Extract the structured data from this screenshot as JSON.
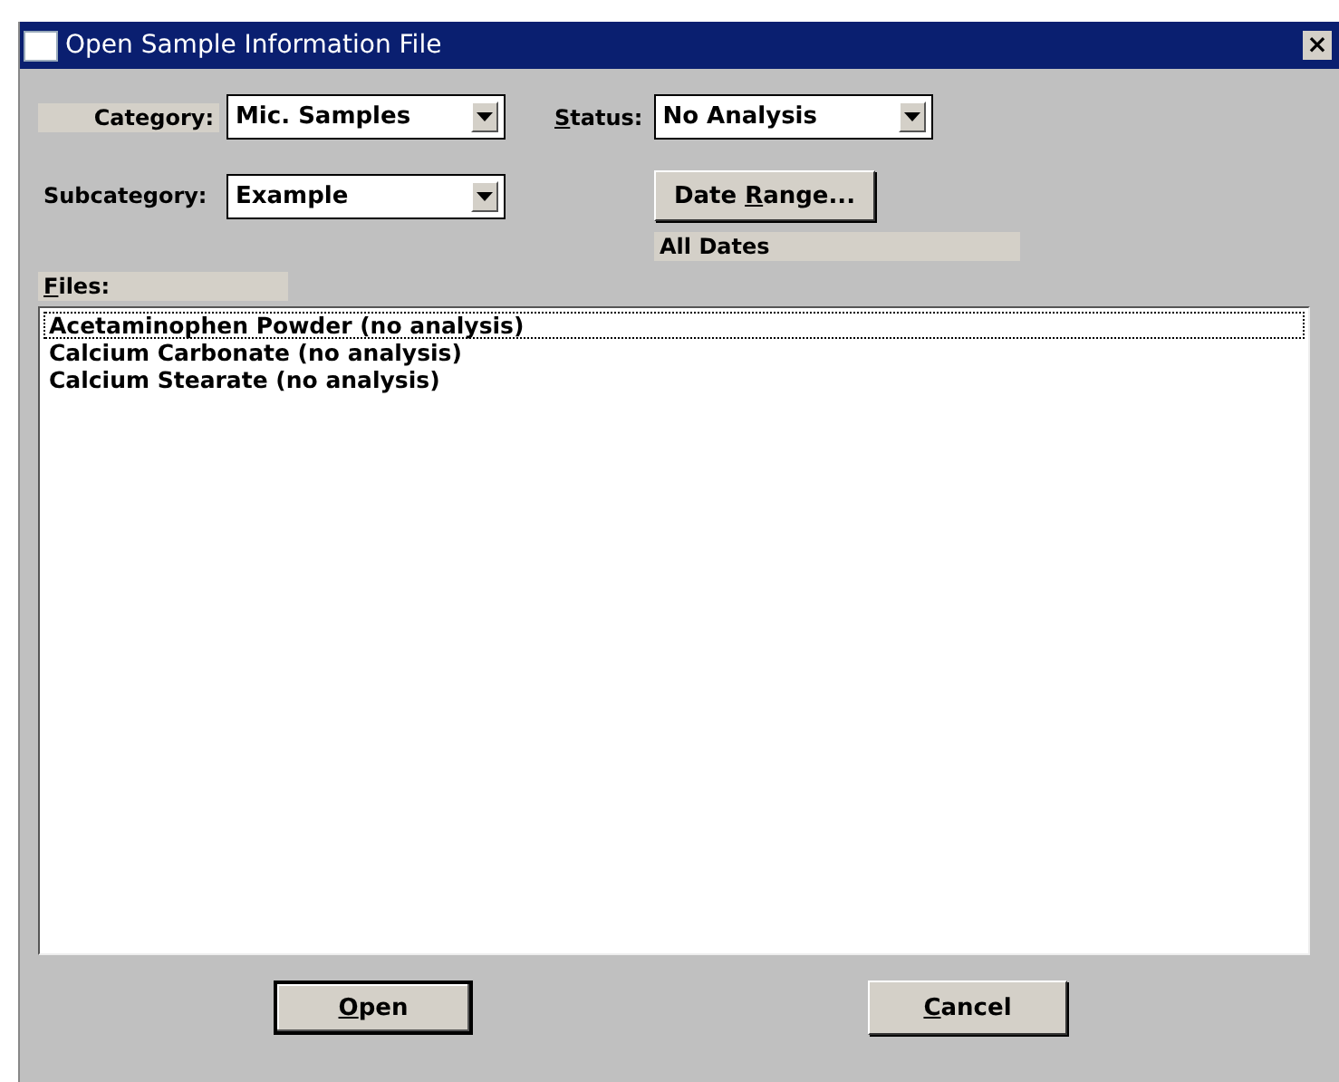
{
  "window": {
    "title": "Open Sample Information File",
    "close": "×"
  },
  "category": {
    "label": {
      "pre": "Category:"
    },
    "value": "Mic. Samples"
  },
  "status": {
    "label": {
      "key": "S",
      "post": "tatus:"
    },
    "value": "No Analysis"
  },
  "subcategory": {
    "label": {
      "pre": "Subcategory:"
    },
    "value": "Example"
  },
  "date_range_button": {
    "pre": "Date ",
    "key": "R",
    "post": "ange..."
  },
  "date_range_text": "All Dates",
  "files": {
    "label": {
      "key": "F",
      "post": "iles:"
    },
    "items": [
      {
        "name": "Acetaminophen Powder (no analysis)",
        "selected": true
      },
      {
        "name": "Calcium Carbonate (no analysis)",
        "selected": false
      },
      {
        "name": "Calcium Stearate (no analysis)",
        "selected": false
      }
    ]
  },
  "buttons": [
    {
      "key": "O",
      "post": "pen",
      "default": true
    },
    {
      "key": "C",
      "post": "ancel",
      "default": false
    }
  ]
}
